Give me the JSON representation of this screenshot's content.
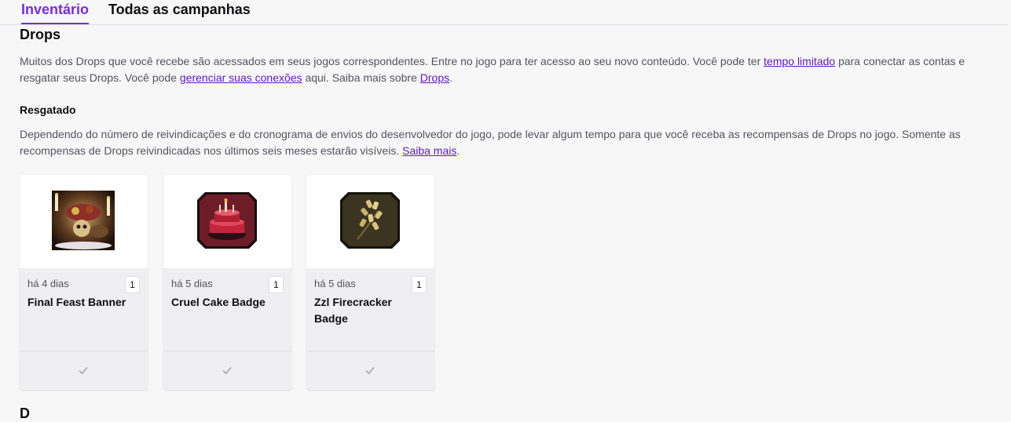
{
  "tabs": [
    {
      "label": "Inventário",
      "active": true
    },
    {
      "label": "Todas as campanhas",
      "active": false
    }
  ],
  "drops": {
    "title": "Drops",
    "intro": {
      "t1": "Muitos dos Drops que você recebe são acessados em seus jogos correspondentes. Entre no jogo para ter acesso ao seu novo conteúdo. Você pode ter ",
      "link1": "tempo limitado",
      "t2": " para conectar as contas e resgatar seus Drops. Você pode ",
      "link2": "gerenciar suas conexões",
      "t3": " aqui. Saiba mais sobre ",
      "link3": "Drops",
      "t4": "."
    }
  },
  "claimed": {
    "title": "Resgatado",
    "desc": "Dependendo do número de reivindicações e do cronograma de envios do desenvolvedor do jogo, pode levar algum tempo para que você receba as recompensas de Drops no jogo. Somente as recompensas de Drops reivindicadas nos últimos seis meses estarão visíveis. ",
    "link": "Saiba mais",
    "end": "."
  },
  "cards": [
    {
      "time": "há 4 dias",
      "qty": "1",
      "title": "Final Feast Banner",
      "icon": "banner-art-icon"
    },
    {
      "time": "há 5 dias",
      "qty": "1",
      "title": "Cruel Cake Badge",
      "icon": "cake-badge-icon"
    },
    {
      "time": "há 5 dias",
      "qty": "1",
      "title": "Zzl Firecracker Badge",
      "icon": "firecracker-badge-icon"
    }
  ],
  "next_section_title": "D",
  "colors": {
    "accent": "#772ce8",
    "link": "#5c16c5",
    "text_muted": "#53535f"
  }
}
